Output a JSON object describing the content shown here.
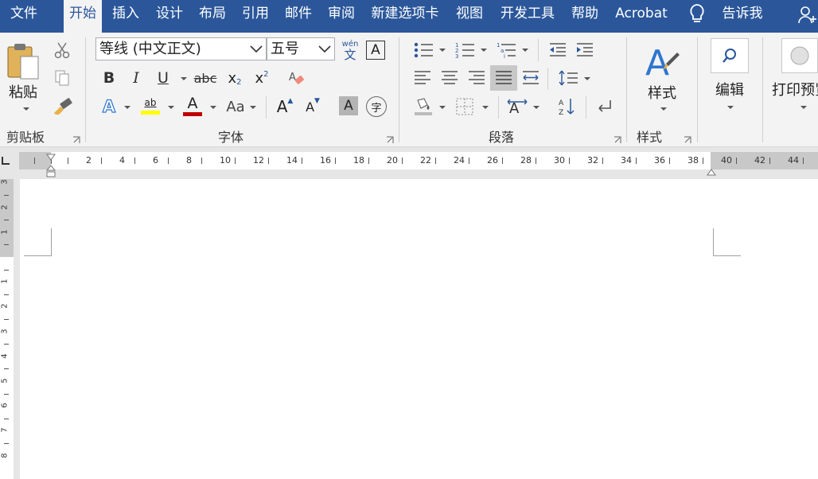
{
  "tabs": [
    {
      "label": "文件",
      "active": false
    },
    {
      "label": "开始",
      "active": true
    },
    {
      "label": "插入",
      "active": false
    },
    {
      "label": "设计",
      "active": false
    },
    {
      "label": "布局",
      "active": false
    },
    {
      "label": "引用",
      "active": false
    },
    {
      "label": "邮件",
      "active": false
    },
    {
      "label": "审阅",
      "active": false
    },
    {
      "label": "新建选项卡",
      "active": false
    },
    {
      "label": "视图",
      "active": false
    },
    {
      "label": "开发工具",
      "active": false
    },
    {
      "label": "帮助",
      "active": false
    },
    {
      "label": "Acrobat",
      "active": false
    }
  ],
  "tell_me": {
    "label": "告诉我",
    "icon": "lightbulb-icon"
  },
  "user_icon": "user-add-icon",
  "colors": {
    "brand": "#2b579a",
    "ribbon": "#f3f3f3",
    "highlight": "#ffff00",
    "font_color": "#c00000",
    "page": "#ffffff"
  },
  "clipboard": {
    "group_label": "剪贴板",
    "paste_label": "粘贴",
    "cut_icon": "scissors-icon",
    "copy_icon": "copy-icon",
    "format_painter_icon": "format-painter-icon"
  },
  "font": {
    "group_label": "字体",
    "font_name": "等线 (中文正文)",
    "font_size": "五号",
    "pinyin_top": "wén",
    "pinyin_bottom": "文",
    "border_char": "A",
    "bold": "B",
    "italic": "I",
    "underline": "U",
    "strike": "abc",
    "subscript": "x",
    "subscript_sub": "2",
    "superscript": "x",
    "superscript_sup": "2",
    "text_effect": "A",
    "highlight_text": "ab",
    "font_color_char": "A",
    "change_case": "Aa",
    "grow_font": "A",
    "shrink_font": "A",
    "char_shading": "A",
    "enclose_char": "字"
  },
  "paragraph": {
    "group_label": "段落"
  },
  "styles": {
    "group_label": "样式",
    "button_label": "样式"
  },
  "editing": {
    "button_label": "编辑"
  },
  "print_preview": {
    "button_label": "打印预览"
  },
  "ruler": {
    "h_numbers": [
      "2",
      "4",
      "6",
      "8",
      "10",
      "12",
      "14",
      "16",
      "18",
      "20",
      "22",
      "24",
      "26",
      "28",
      "30",
      "32",
      "34",
      "36",
      "38",
      "40",
      "42",
      "44",
      "4"
    ],
    "v_numbers_top": [
      "3",
      "2",
      "1"
    ],
    "v_numbers": [
      "1",
      "2",
      "3",
      "4",
      "5",
      "6",
      "7",
      "8"
    ]
  }
}
